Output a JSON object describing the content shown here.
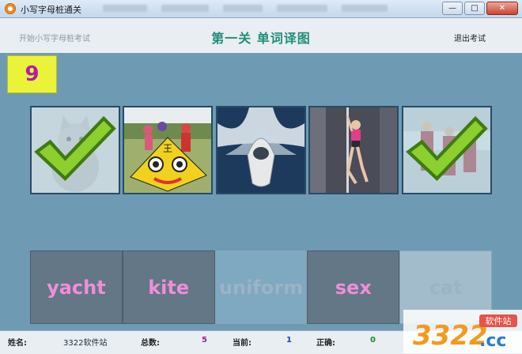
{
  "window": {
    "title": "小写字母桩通关"
  },
  "header": {
    "start_label": "开始小写字母桩考试",
    "level_title": "第一关  单词译图",
    "exit_label": "退出考试"
  },
  "score": {
    "value": "9",
    "color": "#b01ea8",
    "bg": "#eaf23a"
  },
  "pictures": [
    {
      "id": "cat",
      "icon": "kitten-photo",
      "answered": true
    },
    {
      "id": "kite",
      "icon": "kite-photo",
      "answered": false
    },
    {
      "id": "yacht",
      "icon": "yacht-photo",
      "answered": false
    },
    {
      "id": "dancer",
      "icon": "dancer-photo",
      "answered": false
    },
    {
      "id": "uniform",
      "icon": "uniform-photo",
      "answered": true
    }
  ],
  "words": [
    {
      "label": "yacht",
      "used": false
    },
    {
      "label": "kite",
      "used": false
    },
    {
      "label": "uniform",
      "used": true
    },
    {
      "label": "sex",
      "used": false
    },
    {
      "label": "cat",
      "used": true
    }
  ],
  "status": {
    "name_label": "姓名:",
    "name_value": "3322软件站",
    "total_label": "总数:",
    "total_value": "5",
    "current_label": "当前:",
    "current_value": "1",
    "correct_label": "正确:",
    "correct_value": "0"
  },
  "watermark": {
    "brand": "3322",
    "suffix": ".cc",
    "tag": "软件站"
  },
  "colors": {
    "word_text": "#f08ed8",
    "title": "#1e8e78",
    "background": "#6f9ab4"
  }
}
